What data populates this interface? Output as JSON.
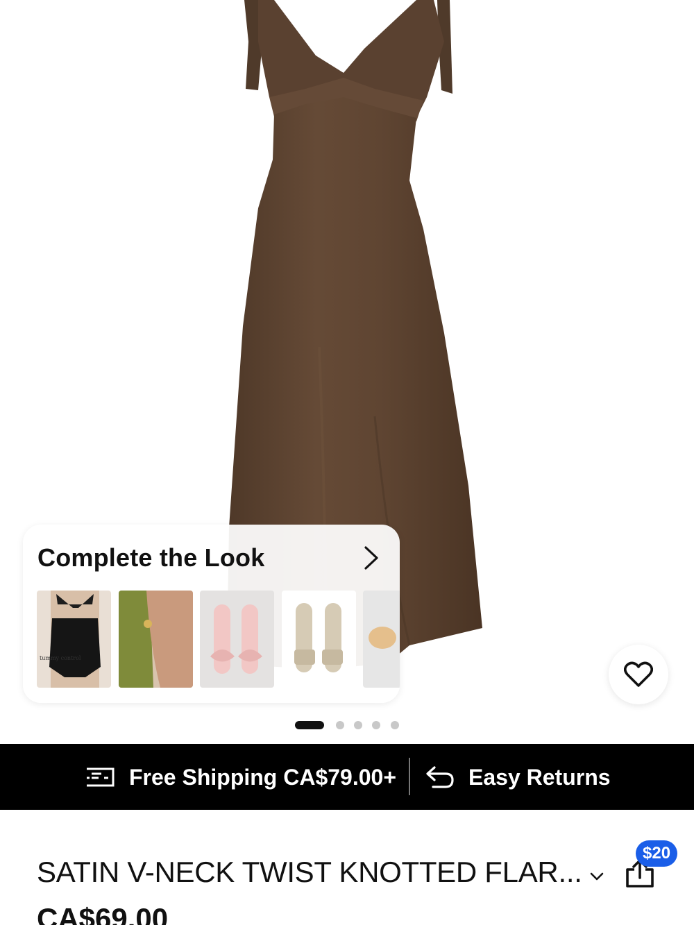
{
  "complete_look": {
    "title": "Complete the Look",
    "items": [
      {
        "name": "tummy control shapewear",
        "caption": "tummy control"
      },
      {
        "name": "green top with arm accessory"
      },
      {
        "name": "pink bow heel sandals"
      },
      {
        "name": "beige slide heel sandals"
      },
      {
        "name": "silicone nipple covers"
      }
    ]
  },
  "carousel": {
    "total": 5,
    "active": 1
  },
  "promo": {
    "shipping_label": "Free Shipping CA$79.00+",
    "returns_label": "Easy Returns"
  },
  "product": {
    "title": "SATIN V-NECK TWIST KNOTTED FLAR...",
    "price": "CA$69.00",
    "share_badge": "$20"
  },
  "icons": {
    "favorite": "heart-outline-icon",
    "shipping": "shipping-icon",
    "returns": "return-arrow-icon",
    "expand": "chevron-down-icon",
    "share": "share-icon",
    "complete_look_more": "chevron-right-icon"
  },
  "colors": {
    "dress": "#5d4330",
    "promo_bar": "#000000",
    "badge": "#1a5ee8"
  }
}
